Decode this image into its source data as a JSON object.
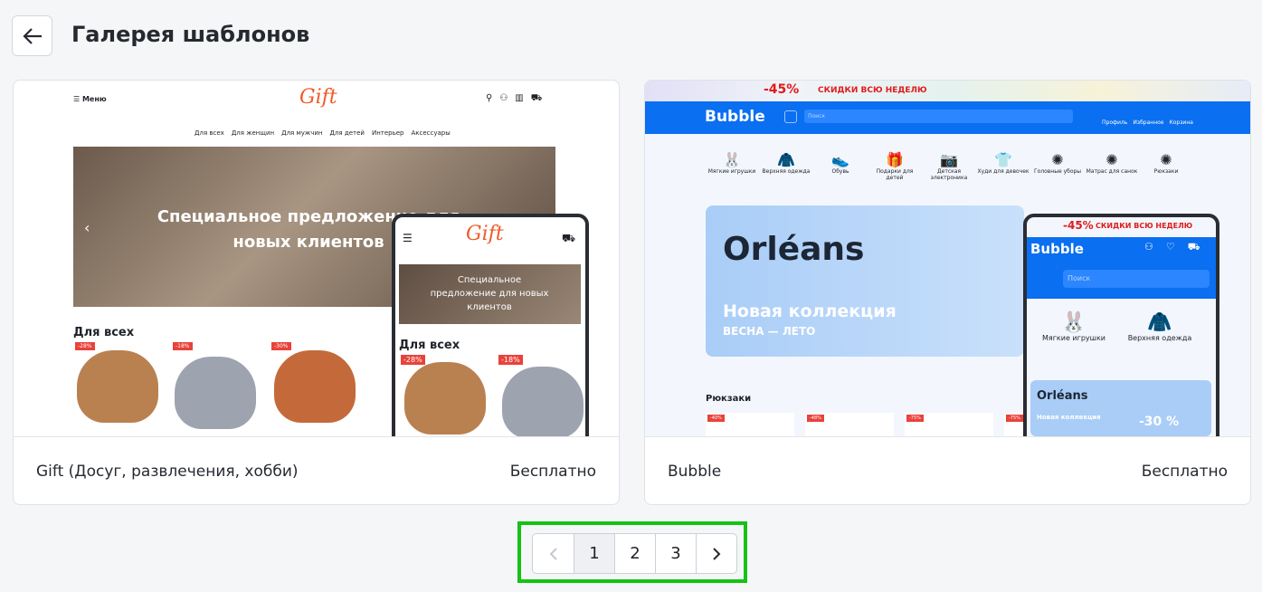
{
  "header": {
    "title": "Галерея шаблонов",
    "back_icon": "arrow-left-icon"
  },
  "templates": [
    {
      "name": "Gift (Досуг, развлечения, хобби)",
      "price": "Бесплатно",
      "preview": {
        "logo": "Gift",
        "menu": "Меню",
        "nav": [
          "Для всех",
          "Для женщин",
          "Для мужчин",
          "Для детей",
          "Интерьер",
          "Аксессуары"
        ],
        "hero": "Специальное предложение для новых клиентов",
        "section": "Для всех",
        "badges": [
          "-28%",
          "-18%",
          "-30%"
        ],
        "mobile_hero": "Специальное предложение для новых клиентов"
      }
    },
    {
      "name": "Bubble",
      "price": "Бесплатно",
      "preview": {
        "promo_pct": "-45%",
        "promo_text": "СКИДКИ ВСЮ НЕДЕЛЮ",
        "logo": "Bubble",
        "search": "Поиск",
        "actions": [
          "Профиль",
          "Избранное",
          "Корзина"
        ],
        "categories": [
          "Мягкие игрушки",
          "Верхняя одежда",
          "Обувь",
          "Подарки для детей",
          "Детская электроника",
          "Худи для девочек",
          "Головные уборы",
          "Матрас для санок",
          "Рюкзаки"
        ],
        "banner_title": "Orléans",
        "banner_sub": "Новая коллекция",
        "banner_season": "ВЕСНА — ЛЕТО",
        "banner_pct": "-30 %",
        "section": "Рюкзаки",
        "badges": [
          "-40%",
          "-48%",
          "-75%",
          "-75%"
        ]
      }
    }
  ],
  "pagination": {
    "pages": [
      "1",
      "2",
      "3"
    ],
    "current": "1",
    "prev_icon": "chevron-left-icon",
    "next_icon": "chevron-right-icon"
  },
  "colors": {
    "gift_accent": "#f05a28",
    "bubble_blue": "#0a6ff0",
    "highlight": "#15c215"
  }
}
